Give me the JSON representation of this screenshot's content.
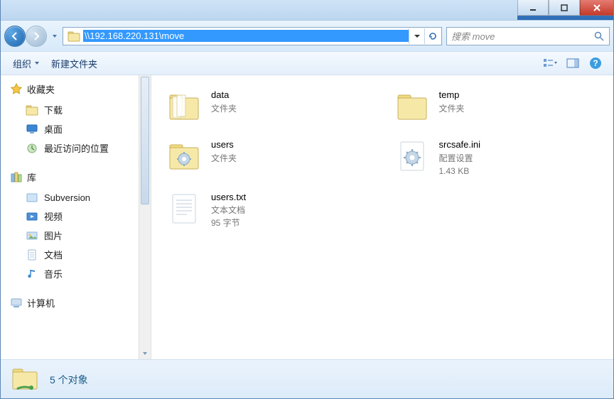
{
  "address": {
    "path": "\\\\192.168.220.131\\move"
  },
  "search": {
    "placeholder": "搜索 move"
  },
  "toolbar": {
    "organize": "组织",
    "newfolder": "新建文件夹"
  },
  "sidebar": {
    "favorites": {
      "label": "收藏夹",
      "items": [
        {
          "label": "下载"
        },
        {
          "label": "桌面"
        },
        {
          "label": "最近访问的位置"
        }
      ]
    },
    "libraries": {
      "label": "库",
      "items": [
        {
          "label": "Subversion"
        },
        {
          "label": "视频"
        },
        {
          "label": "图片"
        },
        {
          "label": "文档"
        },
        {
          "label": "音乐"
        }
      ]
    },
    "computer": {
      "label": "计算机"
    }
  },
  "files": [
    {
      "name": "data",
      "type": "文件夹",
      "extra": "",
      "kind": "folder"
    },
    {
      "name": "temp",
      "type": "文件夹",
      "extra": "",
      "kind": "folder"
    },
    {
      "name": "users",
      "type": "文件夹",
      "extra": "",
      "kind": "folder-gear"
    },
    {
      "name": "srcsafe.ini",
      "type": "配置设置",
      "extra": "1.43 KB",
      "kind": "ini"
    },
    {
      "name": "users.txt",
      "type": "文本文档",
      "extra": "95 字节",
      "kind": "txt"
    }
  ],
  "status": {
    "count": "5 个对象"
  }
}
